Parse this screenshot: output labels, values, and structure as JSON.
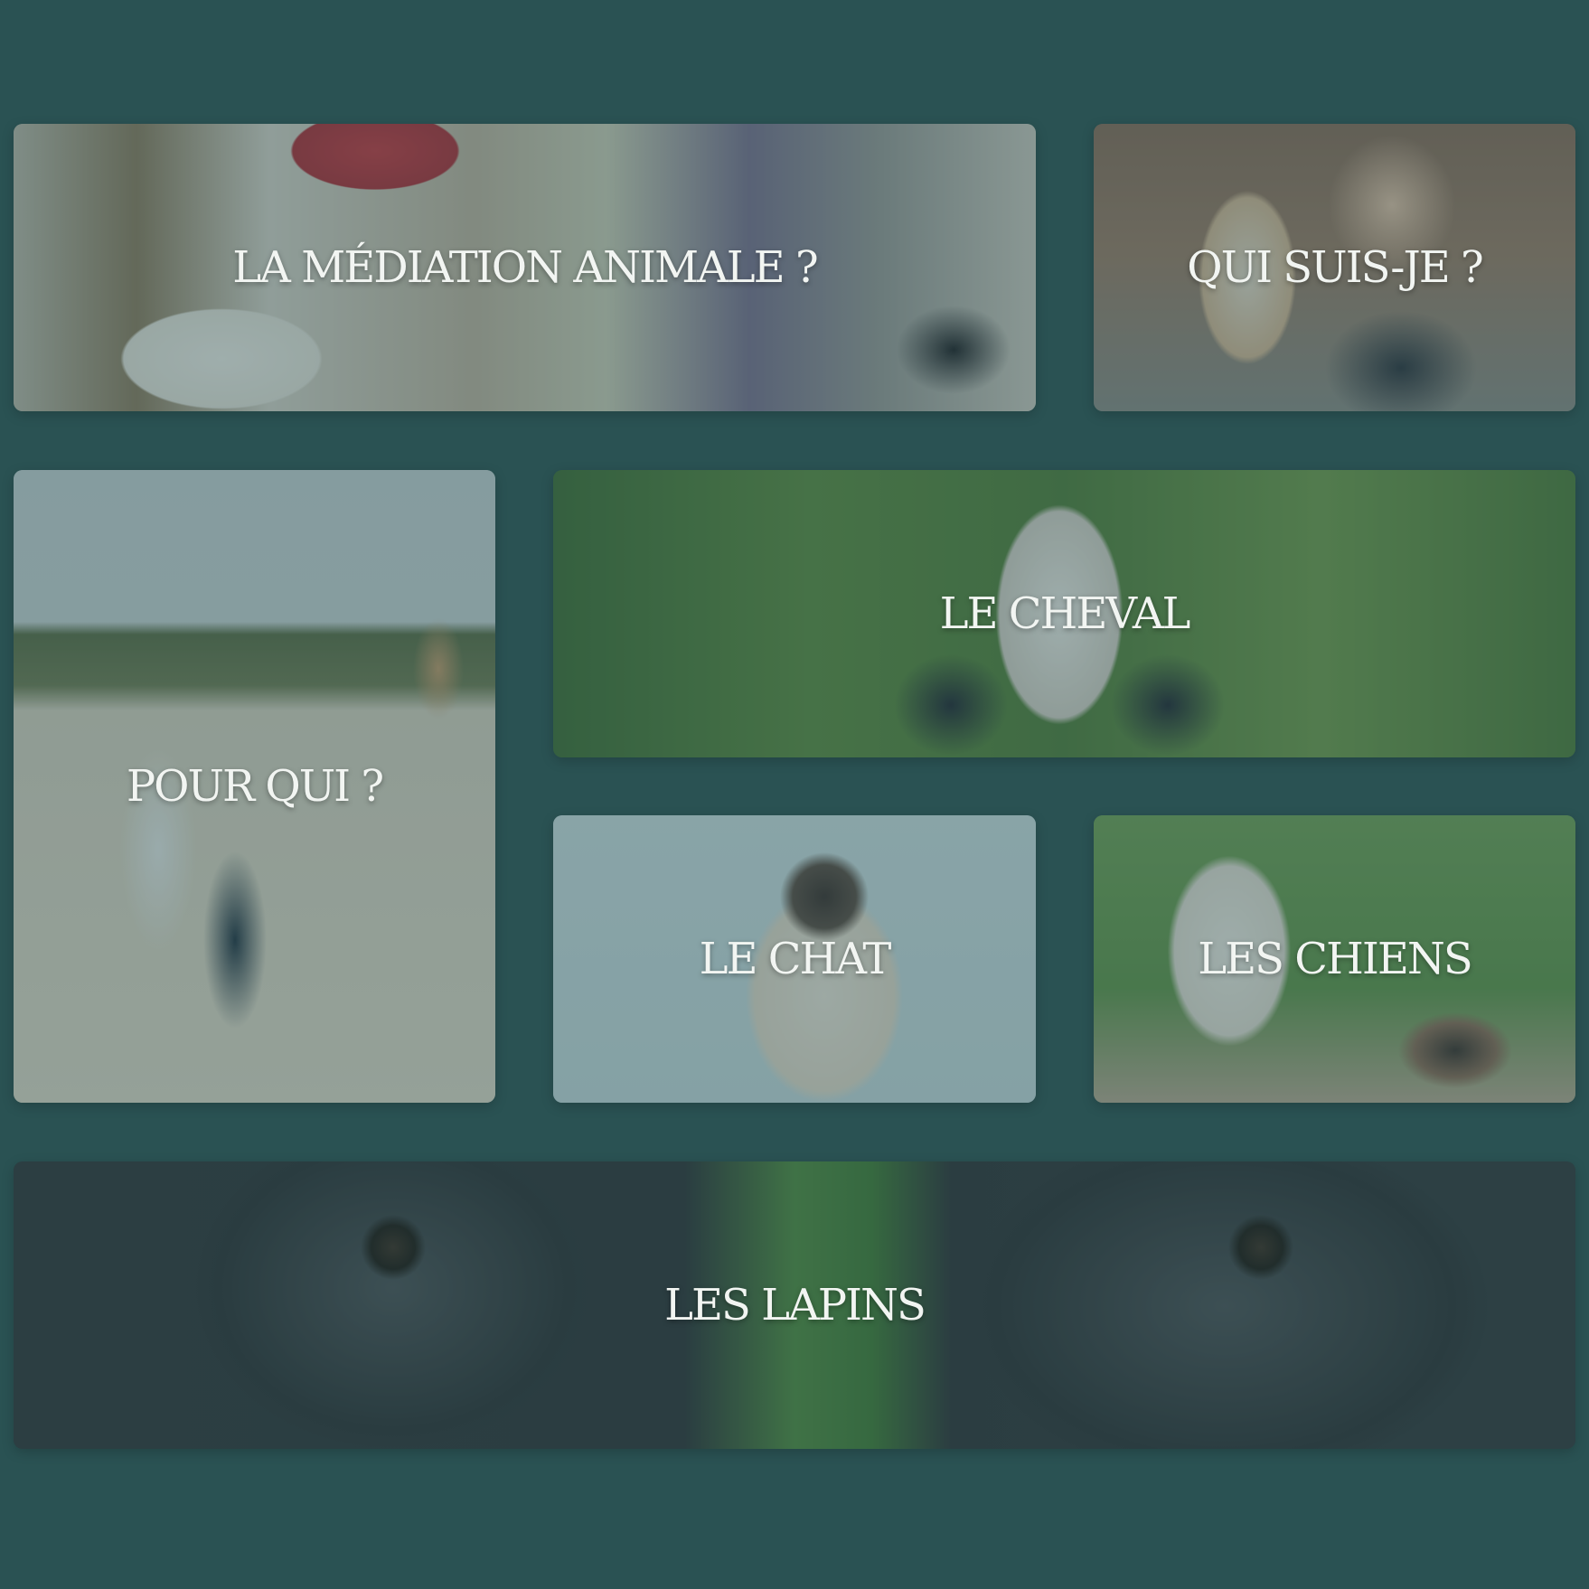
{
  "tiles": {
    "mediation": {
      "label": "LA MÉDIATION ANIMALE ?"
    },
    "quisuisje": {
      "label": "QUI SUIS-JE ?"
    },
    "pourqui": {
      "label": "POUR QUI ?"
    },
    "cheval": {
      "label": "LE CHEVAL"
    },
    "chat": {
      "label": "LE CHAT"
    },
    "chiens": {
      "label": "LES CHIENS"
    },
    "lapins": {
      "label": "LES LAPINS"
    }
  },
  "colors": {
    "background": "#2a5253",
    "label_text": "#f2f5f2",
    "overlay_tint": "#2a5253"
  }
}
